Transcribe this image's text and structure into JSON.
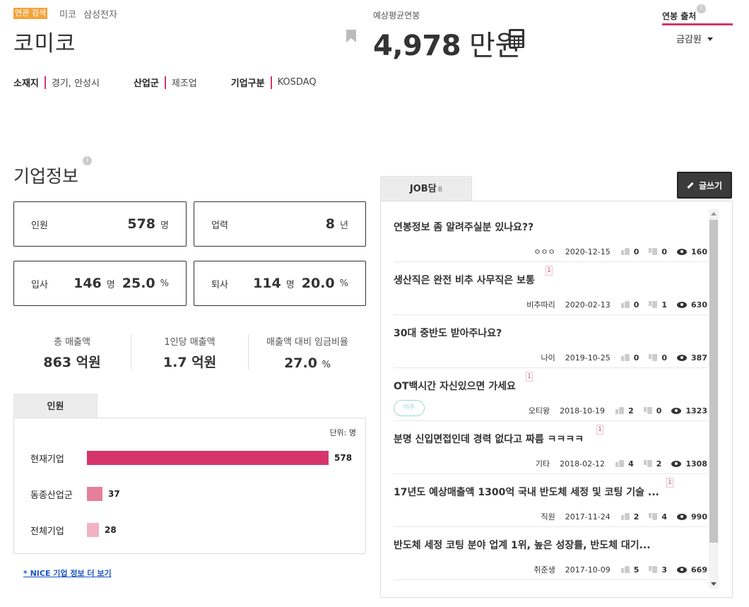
{
  "related": {
    "tag": "연관 검색",
    "links": [
      "미코",
      "삼성전자"
    ]
  },
  "company": {
    "name": "코미코"
  },
  "salary": {
    "caption": "예상평균연봉",
    "value": "4,978",
    "unit": "만원"
  },
  "source": {
    "title": "연봉 출처",
    "info": "i",
    "selected": "금감원"
  },
  "meta": [
    {
      "label": "소재지",
      "value": "경기, 안성시"
    },
    {
      "label": "산업군",
      "value": "제조업"
    },
    {
      "label": "기업구분",
      "value": "KOSDAQ"
    }
  ],
  "company_info": {
    "title": "기업정보",
    "info": "i",
    "staff": {
      "label": "인원",
      "value": "578",
      "unit": "명"
    },
    "years": {
      "label": "업력",
      "value": "8",
      "unit": "년"
    },
    "hire": {
      "label": "입사",
      "value": "146",
      "unit": "명",
      "pct": "25.0",
      "pct_unit": "%"
    },
    "leave": {
      "label": "퇴사",
      "value": "114",
      "unit": "명",
      "pct": "20.0",
      "pct_unit": "%"
    },
    "summary": [
      {
        "caption": "총 매출액",
        "value": "863 억원"
      },
      {
        "caption": "1인당 매출액",
        "value": "1.7 억원"
      },
      {
        "caption": "매출액 대비 임금비율",
        "value": "27.0",
        "suffix": "%"
      }
    ]
  },
  "people_tab": {
    "label": "인원"
  },
  "chart_data": {
    "type": "bar",
    "unit_label": "단위: 명",
    "categories": [
      "현재기업",
      "동종산업군",
      "전체기업"
    ],
    "values": [
      578,
      37,
      28
    ],
    "colors": [
      "#d6356b",
      "#e67f9a",
      "#f1b3c4"
    ],
    "orientation": "horizontal"
  },
  "nice_link": "* NICE 기업 정보 더 보기",
  "job": {
    "tab_label": "JOB담",
    "count": "8",
    "write_label": "글쓰기",
    "posts": [
      {
        "title": "연봉정보 좀 알려주실분 있나요??",
        "badge": "",
        "tag": "",
        "author": "ㅇㅇㅇ",
        "date": "2020-12-15",
        "likes": "0",
        "dislikes": "0",
        "views": "160"
      },
      {
        "title": "생산직은 완전 비추 사무직은 보통",
        "badge": "1",
        "tag": "",
        "author": "비추따리",
        "date": "2020-02-13",
        "likes": "0",
        "dislikes": "1",
        "views": "630"
      },
      {
        "title": "30대 중반도 받아주나요?",
        "badge": "",
        "tag": "",
        "author": "나이",
        "date": "2019-10-25",
        "likes": "0",
        "dislikes": "0",
        "views": "387"
      },
      {
        "title": "OT백시간 자신있으면 가세요",
        "badge": "1",
        "tag": "비추",
        "author": "오티왕",
        "date": "2018-10-19",
        "likes": "2",
        "dislikes": "0",
        "views": "1323"
      },
      {
        "title": "분명 신입면접인데 경력 없다고 짜름 ㅋㅋㅋㅋ",
        "badge": "1",
        "tag": "",
        "author": "기타",
        "date": "2018-02-12",
        "likes": "4",
        "dislikes": "2",
        "views": "1308"
      },
      {
        "title": "17년도 예상매출액 1300억 국내 반도체 세정 및 코팅 기술 ...",
        "badge": "1",
        "tag": "",
        "author": "직원",
        "date": "2017-11-24",
        "likes": "2",
        "dislikes": "4",
        "views": "990"
      },
      {
        "title": "반도체 세정 코팅 분야 업계 1위, 높은 성장률, 반도체 대기...",
        "badge": "",
        "tag": "",
        "author": "취준생",
        "date": "2017-10-09",
        "likes": "5",
        "dislikes": "3",
        "views": "669"
      }
    ]
  }
}
